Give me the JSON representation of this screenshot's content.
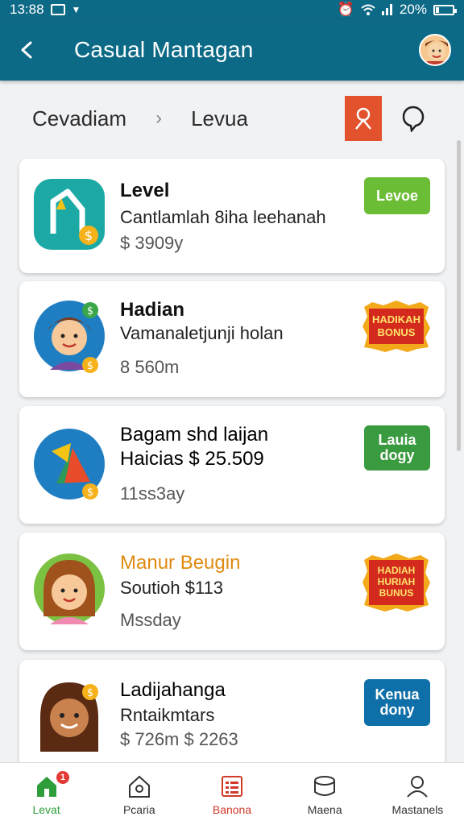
{
  "status_bar": {
    "time": "13:88",
    "battery": "20%",
    "battery_level": 0.2
  },
  "app_bar": {
    "title": "Casual Mantagan"
  },
  "breadcrumb": {
    "items": [
      "Cevadiam",
      "Levua"
    ],
    "separator": "›"
  },
  "cards": [
    {
      "title": "Level",
      "subtitle": "Cantlamlah 8iha leehanah",
      "meta": "$ 3909y",
      "tag": "Levoe"
    },
    {
      "title": "Hadian",
      "subtitle": "Vamanaletjunji holan",
      "meta": "8 560m",
      "tag": "HADIKAH BONUS"
    },
    {
      "title": "Bagam shd laijan",
      "subtitle": "Haicias $ 25.509",
      "meta": "11ss3ay",
      "tag": "Lauia dogy"
    },
    {
      "title": "Manur Beugin",
      "subtitle": "Soutioh $113",
      "meta": "Mssday",
      "tag": "HADIAH HURIAH BUNUS"
    },
    {
      "title": "Ladijahanga",
      "subtitle": "Rntaikmtars",
      "meta": "$ 726m  $ 2263",
      "tag": "Kenua dony"
    }
  ],
  "bottom_nav": {
    "badge": "1",
    "items": [
      "Levat",
      "Pcaria",
      "Banona",
      "Maena",
      "Mastanels"
    ]
  },
  "colors": {
    "primary": "#0d6a86",
    "accent_orange": "#e2522c",
    "green": "#6cbd36",
    "blue": "#0f6fa8",
    "title_orange": "#e08a10"
  },
  "icons": [
    "back-arrow-icon",
    "user-avatar",
    "filter-person-icon",
    "chat-bubble-icon",
    "home-icon",
    "search-home-icon",
    "list-icon",
    "box-icon",
    "person-icon"
  ]
}
